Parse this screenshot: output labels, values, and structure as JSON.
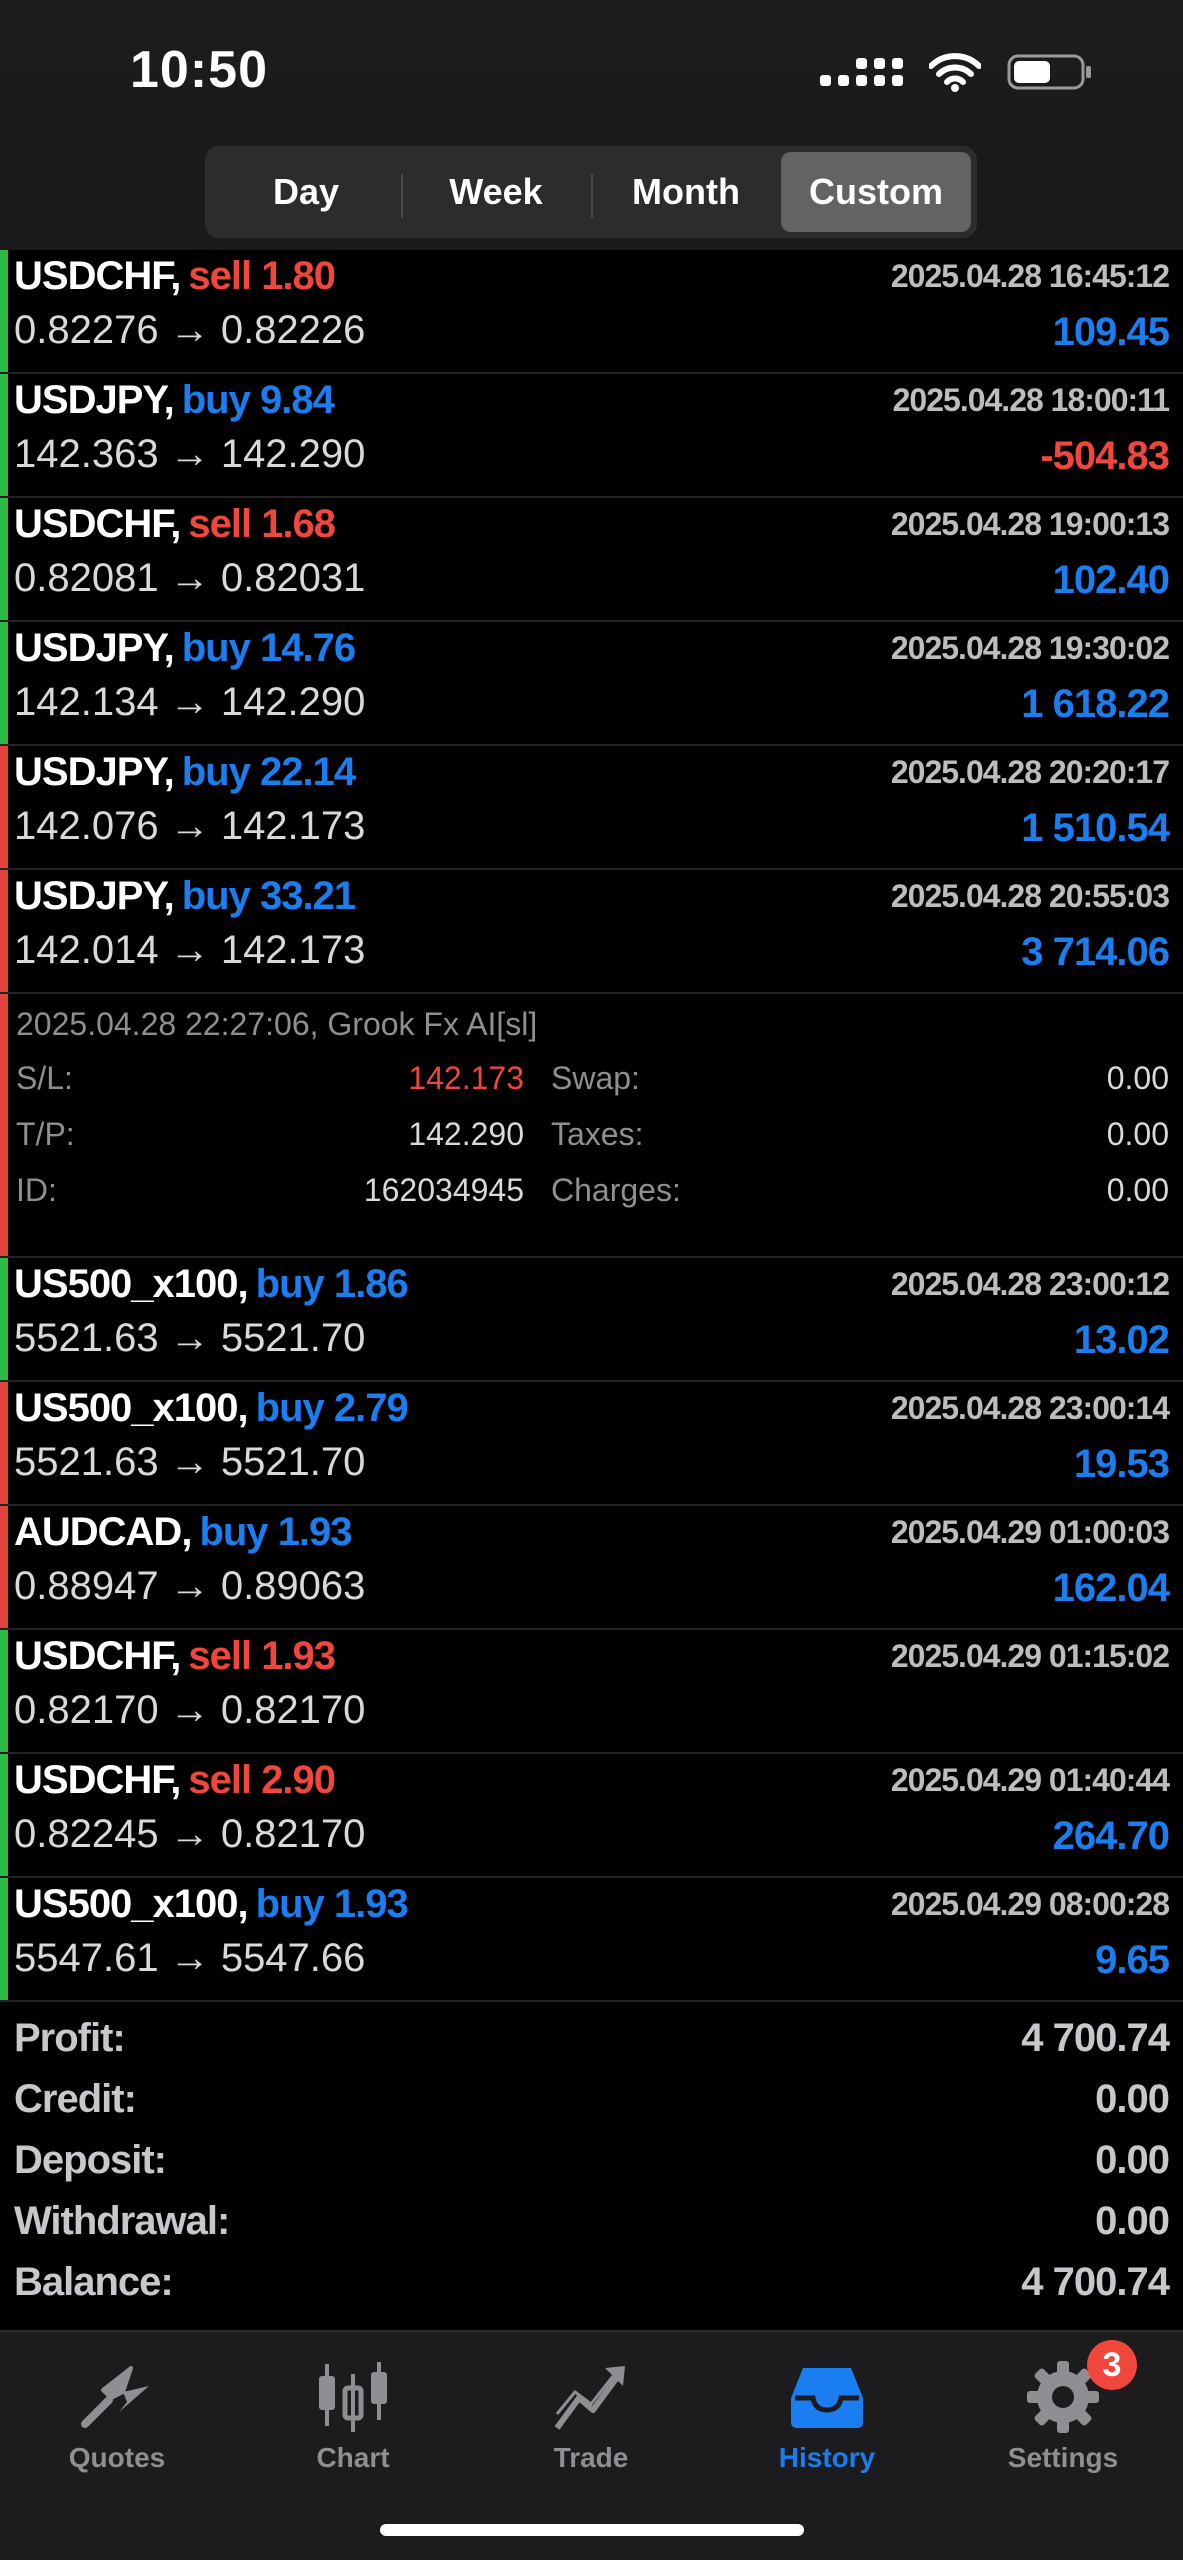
{
  "status": {
    "time": "10:50"
  },
  "periods": [
    "Day",
    "Week",
    "Month",
    "Custom"
  ],
  "active_period": "Custom",
  "colors": {
    "buy": "#1a7ef0",
    "sell": "#f0463c",
    "profit_bar": "#2dbb46",
    "loss_bar": "#e0433c"
  },
  "deals": [
    {
      "symbol": "USDCHF,",
      "side": "sell",
      "volume": "1.80",
      "prices": "0.82276 → 0.82226",
      "datetime": "2025.04.28 16:45:12",
      "profit": "109.45",
      "bar": "green"
    },
    {
      "symbol": "USDJPY,",
      "side": "buy",
      "volume": "9.84",
      "prices": "142.363 → 142.290",
      "datetime": "2025.04.28 18:00:11",
      "profit": "-504.83",
      "bar": "green"
    },
    {
      "symbol": "USDCHF,",
      "side": "sell",
      "volume": "1.68",
      "prices": "0.82081 → 0.82031",
      "datetime": "2025.04.28 19:00:13",
      "profit": "102.40",
      "bar": "green"
    },
    {
      "symbol": "USDJPY,",
      "side": "buy",
      "volume": "14.76",
      "prices": "142.134 → 142.290",
      "datetime": "2025.04.28 19:30:02",
      "profit": "1 618.22",
      "bar": "green"
    },
    {
      "symbol": "USDJPY,",
      "side": "buy",
      "volume": "22.14",
      "prices": "142.076 → 142.173",
      "datetime": "2025.04.28 20:20:17",
      "profit": "1 510.54",
      "bar": "red"
    },
    {
      "symbol": "USDJPY,",
      "side": "buy",
      "volume": "33.21",
      "prices": "142.014 → 142.173",
      "datetime": "2025.04.28 20:55:03",
      "profit": "3 714.06",
      "bar": "red"
    }
  ],
  "expanded_deal": {
    "meta": "2025.04.28 22:27:06,  Grook Fx AI[sl]",
    "sl_label": "S/L:",
    "sl": "142.173",
    "tp_label": "T/P:",
    "tp": "142.290",
    "id_label": "ID:",
    "id": "162034945",
    "swap_label": "Swap:",
    "swap": "0.00",
    "taxes_label": "Taxes:",
    "taxes": "0.00",
    "charges_label": "Charges:",
    "charges": "0.00"
  },
  "deals2": [
    {
      "symbol": "US500_x100,",
      "side": "buy",
      "volume": "1.86",
      "prices": "5521.63 → 5521.70",
      "datetime": "2025.04.28 23:00:12",
      "profit": "13.02",
      "bar": "green"
    },
    {
      "symbol": "US500_x100,",
      "side": "buy",
      "volume": "2.79",
      "prices": "5521.63 → 5521.70",
      "datetime": "2025.04.28 23:00:14",
      "profit": "19.53",
      "bar": "red"
    },
    {
      "symbol": "AUDCAD,",
      "side": "buy",
      "volume": "1.93",
      "prices": "0.88947 → 0.89063",
      "datetime": "2025.04.29 01:00:03",
      "profit": "162.04",
      "bar": "red"
    },
    {
      "symbol": "USDCHF,",
      "side": "sell",
      "volume": "1.93",
      "prices": "0.82170 → 0.82170",
      "datetime": "2025.04.29 01:15:02",
      "profit": "",
      "bar": "green"
    },
    {
      "symbol": "USDCHF,",
      "side": "sell",
      "volume": "2.90",
      "prices": "0.82245 → 0.82170",
      "datetime": "2025.04.29 01:40:44",
      "profit": "264.70",
      "bar": "green"
    },
    {
      "symbol": "US500_x100,",
      "side": "buy",
      "volume": "1.93",
      "prices": "5547.61 → 5547.66",
      "datetime": "2025.04.29 08:00:28",
      "profit": "9.65",
      "bar": "green"
    }
  ],
  "summary": [
    {
      "label": "Profit:",
      "value": "4 700.74"
    },
    {
      "label": "Credit:",
      "value": "0.00"
    },
    {
      "label": "Deposit:",
      "value": "0.00"
    },
    {
      "label": "Withdrawal:",
      "value": "0.00"
    },
    {
      "label": "Balance:",
      "value": "4 700.74"
    }
  ],
  "tabs": [
    {
      "label": "Quotes",
      "icon": "quotes-icon"
    },
    {
      "label": "Chart",
      "icon": "chart-icon"
    },
    {
      "label": "Trade",
      "icon": "trade-icon"
    },
    {
      "label": "History",
      "icon": "history-icon"
    },
    {
      "label": "Settings",
      "icon": "settings-icon"
    }
  ],
  "active_tab": "History",
  "settings_badge": "3"
}
